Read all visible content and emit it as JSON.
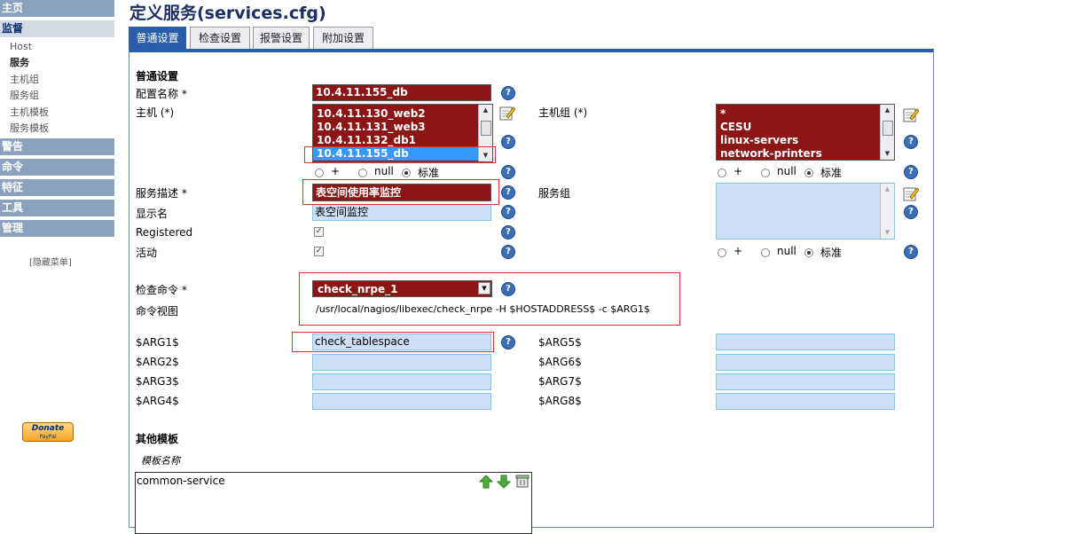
{
  "sidebar": {
    "home": "主页",
    "monitor": "监督",
    "monitor_items": [
      "Host",
      "服务",
      "主机组",
      "服务组",
      "主机模板",
      "服务模板"
    ],
    "alerts": "警告",
    "commands": "命令",
    "specialties": "特征",
    "tools": "工具",
    "admin": "管理",
    "hide_menu": "[隐藏菜单]",
    "donate_top": "Donate",
    "donate_bottom": "PayPal"
  },
  "page_title": "定义服务(services.cfg)",
  "tabs": [
    "普通设置",
    "检查设置",
    "报警设置",
    "附加设置"
  ],
  "form": {
    "section_general": "普通设置",
    "config_name_label": "配置名称 *",
    "config_name_value": "10.4.11.155_db",
    "host_label": "主机 (*)",
    "host_options": [
      "10.4.11.130_web2",
      "10.4.11.131_web3",
      "10.4.11.132_db1",
      "10.4.11.155_db"
    ],
    "host_selected": "10.4.11.155_db",
    "hostgroup_label": "主机组 (*)",
    "hostgroup_options": [
      "*",
      "CESU",
      "linux-servers",
      "network-printers"
    ],
    "radio_plus": "+",
    "radio_null": "null",
    "radio_standard": "标准",
    "service_desc_label": "服务描述 *",
    "service_desc_value": "表空间使用率监控",
    "servicegroup_label": "服务组",
    "display_name_label": "显示名",
    "display_name_value": "表空间监控",
    "registered_label": "Registered",
    "active_label": "活动",
    "check_command_label": "检查命令 *",
    "check_command_value": "check_nrpe_1",
    "command_view_label": "命令视图",
    "command_view_value": "/usr/local/nagios/libexec/check_nrpe -H $HOSTADDRESS$ -c $ARG1$",
    "args_left": [
      "$ARG1$",
      "$ARG2$",
      "$ARG3$",
      "$ARG4$"
    ],
    "args_right": [
      "$ARG5$",
      "$ARG6$",
      "$ARG7$",
      "$ARG8$"
    ],
    "arg1_value": "check_tablespace",
    "other_templates_label": "其他模板",
    "template_name_label": "模板名称",
    "template_items": [
      "common-service"
    ]
  },
  "colors": {
    "red_field": "#8c1515",
    "blue_field": "#cddff6",
    "tab_active": "#2a5ea8",
    "sidebar_header": "#8aa2be",
    "highlight_box": "#e03030"
  }
}
